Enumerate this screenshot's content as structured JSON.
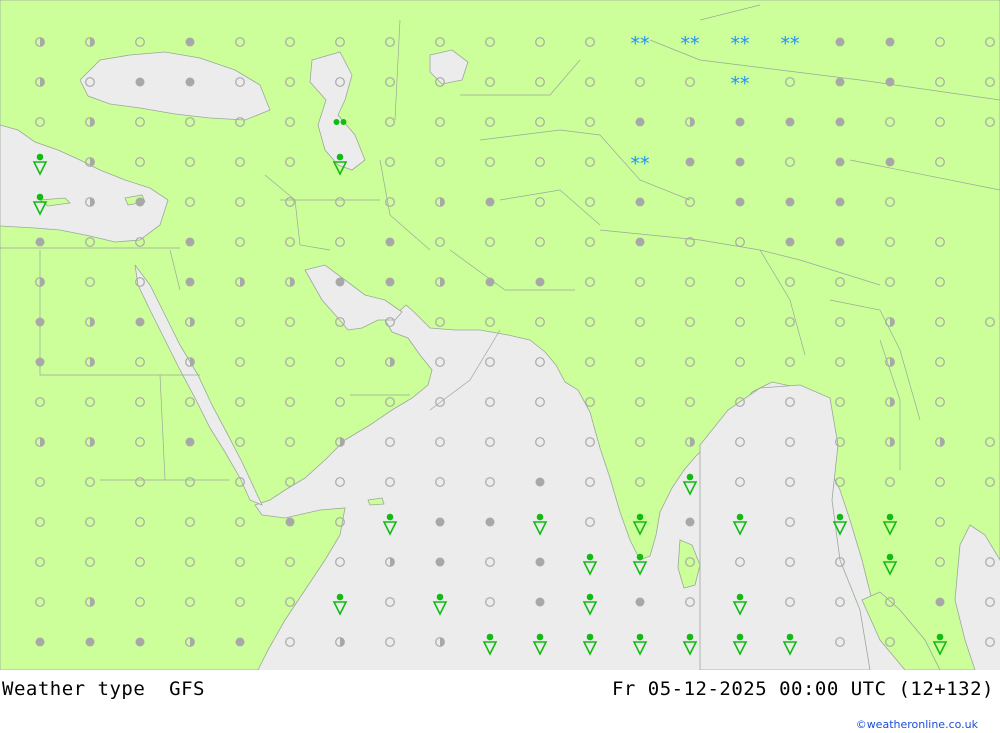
{
  "colors": {
    "land": "#ccff99",
    "water": "#ececec",
    "border": "#9aa89a",
    "dot": "#a8a8a8",
    "rain": "#11bb11",
    "snow": "#1e90ff",
    "title": "#000000",
    "credit": "#1a4fd6"
  },
  "footer": {
    "product": "Weather type  GFS",
    "valid_time": "Fr 05-12-2025 00:00 UTC (12+132)",
    "credit": "©weatheronline.co.uk"
  },
  "legend_symbols": {
    "dot_types": [
      "open-circle-icon",
      "filled-circle-icon",
      "half-circle-icon"
    ],
    "precip_types": [
      "rain-shower-icon",
      "drizzle-icon",
      "snow-icon"
    ]
  },
  "grid": {
    "cols": 19,
    "rows": 16,
    "cells": [
      "hhOFOOOOOOOOSSSSFFOO",
      "hOFFOOOOOOOOOOSOFFOO",
      "OhOOOODOOOOOFhFFFOOO",
      "RhOOOOROOOOOSFFOFFO",
      "RhFOOOOOhFOOFOFFFO",
      "FOOFOOOFOOOOFOOFFOO",
      "hOOFhhFFhFFOOOOOOOO",
      "FhFhOOOOOOOOOOOOOhOO",
      "FhOhOOOhOOOOOOOOOhO",
      "OOOOOOOOOOOOOOOOOhO",
      "hhOFOOhOOOOOOhOOOhhO",
      "OOOOOOOOOOFOOROOOOOOR",
      "OOOOOFORFFRORFRORRO",
      "OOOOOOOhFOFRROOOOROOR",
      "OhOOOOROROFRFOROOOFO",
      "FFFhFOhOhRRRRRRROOROO"
    ]
  }
}
